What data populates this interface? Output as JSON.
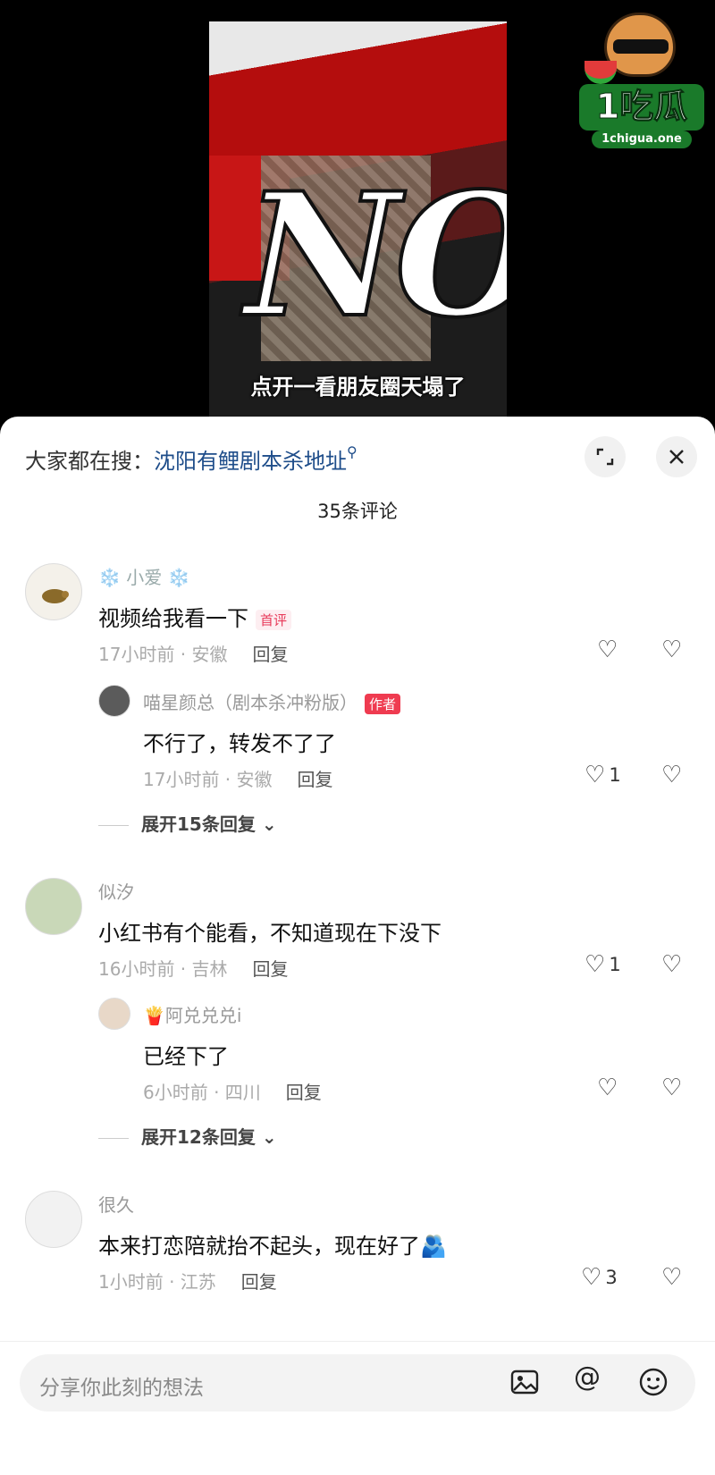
{
  "video": {
    "overlay_text": "NO",
    "caption": "点开一看朋友圈天塌了"
  },
  "watermark": {
    "brand": "1吃瓜",
    "domain": "1chigua.one"
  },
  "header": {
    "search_prefix": "大家都在搜：",
    "search_keyword": "沈阳有鲤剧本杀地址",
    "comment_count": "35条评论"
  },
  "comments": [
    {
      "user": "❄️ 小爱 ❄️",
      "text": "视频给我看一下",
      "badge": "首评",
      "meta": "17小时前 · 安徽",
      "reply_label": "回复",
      "likes": "",
      "replies": [
        {
          "user": "喵星颜总（剧本杀冲粉版）",
          "badge": "作者",
          "text": "不行了，转发不了了",
          "meta": "17小时前 · 安徽",
          "reply_label": "回复",
          "likes": "1"
        }
      ],
      "expand": "展开15条回复"
    },
    {
      "user": "似汐",
      "text": "小红书有个能看，不知道现在下没下",
      "meta": "16小时前 · 吉林",
      "reply_label": "回复",
      "likes": "1",
      "replies": [
        {
          "user": "🍟阿兑兑兑i",
          "text": "已经下了",
          "meta": "6小时前 · 四川",
          "reply_label": "回复",
          "likes": ""
        }
      ],
      "expand": "展开12条回复"
    },
    {
      "user": "很久",
      "text": "本来打恋陪就抬不起头，现在好了🫂",
      "meta": "1小时前 · 江苏",
      "reply_label": "回复",
      "likes": "3"
    }
  ],
  "composer": {
    "placeholder": "分享你此刻的想法"
  },
  "icons": {
    "like": "heart-outline-icon",
    "dislike": "broken-heart-icon",
    "expand": "expand-icon",
    "close": "close-icon",
    "image": "image-icon",
    "mention": "at-icon",
    "emoji": "emoji-icon"
  }
}
